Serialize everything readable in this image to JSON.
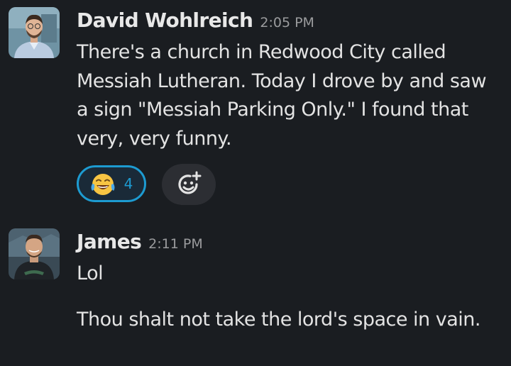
{
  "messages": [
    {
      "author": "David Wohlreich",
      "time": "2:05 PM",
      "text": "There's a church in Redwood City called Messiah Lutheran. Today I drove by and saw a sign \"Messiah Parking Only.\" I found that very, very funny.",
      "reaction": {
        "icon": "joy-emoji-icon",
        "count": "4"
      },
      "add_reaction_icon": "add-reaction-icon"
    },
    {
      "author": "James",
      "time": "2:11 PM",
      "text_1": "Lol",
      "text_2": "Thou shalt not take the lord's space in vain."
    }
  ],
  "colors": {
    "background": "#1a1d21",
    "reaction_accent": "#1d9bd1"
  }
}
